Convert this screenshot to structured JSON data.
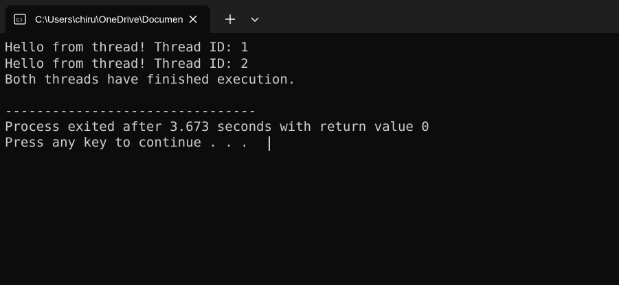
{
  "tab": {
    "icon": "console-icon",
    "title": "C:\\Users\\chiru\\OneDrive\\Documents\\thread.exe",
    "close_icon": "close-icon"
  },
  "toolbar": {
    "new_tab_icon": "plus-icon",
    "dropdown_icon": "chevron-down-icon"
  },
  "console": {
    "lines": [
      "Hello from thread! Thread ID: 1",
      "Hello from thread! Thread ID: 2",
      "Both threads have finished execution.",
      "",
      "--------------------------------",
      "Process exited after 3.673 seconds with return value 0",
      "Press any key to continue . . ."
    ]
  },
  "colors": {
    "background": "#0c0c0c",
    "titlebar": "#1f1f1f",
    "text": "#cccccc"
  }
}
